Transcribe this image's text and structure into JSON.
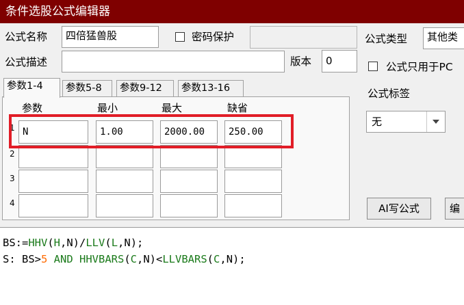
{
  "window": {
    "title": "条件选股公式编辑器"
  },
  "form": {
    "name_label": "公式名称",
    "name_value": "四倍猛兽股",
    "password_label": "密码保护",
    "password_checked": false,
    "password_value": "",
    "type_label": "公式类型",
    "type_value": "其他类",
    "desc_label": "公式描述",
    "desc_value": "",
    "version_label": "版本",
    "version_value": "0",
    "pc_only_label": "公式只用于PC",
    "pc_only_checked": false,
    "tag_label": "公式标签",
    "tag_value": "无"
  },
  "tabs": [
    {
      "label": "参数1-4",
      "active": true
    },
    {
      "label": "参数5-8",
      "active": false
    },
    {
      "label": "参数9-12",
      "active": false
    },
    {
      "label": "参数13-16",
      "active": false
    }
  ],
  "params": {
    "headers": [
      "参数",
      "最小",
      "最大",
      "缺省"
    ],
    "rows": [
      {
        "num": "1",
        "name": "N",
        "min": "1.00",
        "max": "2000.00",
        "default": "250.00"
      },
      {
        "num": "2",
        "name": "",
        "min": "",
        "max": "",
        "default": ""
      },
      {
        "num": "3",
        "name": "",
        "min": "",
        "max": "",
        "default": ""
      },
      {
        "num": "4",
        "name": "",
        "min": "",
        "max": "",
        "default": ""
      }
    ]
  },
  "buttons": {
    "ai_write": "AI写公式",
    "edit": "编"
  },
  "code": {
    "line1": [
      {
        "t": "BS:=",
        "c": "k"
      },
      {
        "t": "HHV",
        "c": "f"
      },
      {
        "t": "(",
        "c": "k"
      },
      {
        "t": "H",
        "c": "f"
      },
      {
        "t": ",N)/",
        "c": "k"
      },
      {
        "t": "LLV",
        "c": "f"
      },
      {
        "t": "(",
        "c": "k"
      },
      {
        "t": "L",
        "c": "f"
      },
      {
        "t": ",N);",
        "c": "k"
      }
    ],
    "line2": [
      {
        "t": "S: BS>",
        "c": "k"
      },
      {
        "t": "5",
        "c": "n"
      },
      {
        "t": " AND HHVBARS",
        "c": "f"
      },
      {
        "t": "(",
        "c": "k"
      },
      {
        "t": "C",
        "c": "f"
      },
      {
        "t": ",N)<",
        "c": "k"
      },
      {
        "t": "LLVBARS",
        "c": "f"
      },
      {
        "t": "(",
        "c": "k"
      },
      {
        "t": "C",
        "c": "f"
      },
      {
        "t": ",N);",
        "c": "k"
      }
    ]
  },
  "colors": {
    "titlebar": "#7f0000",
    "highlight": "#e11d27",
    "function": "#1a7a1a",
    "number": "#ff6a00"
  }
}
